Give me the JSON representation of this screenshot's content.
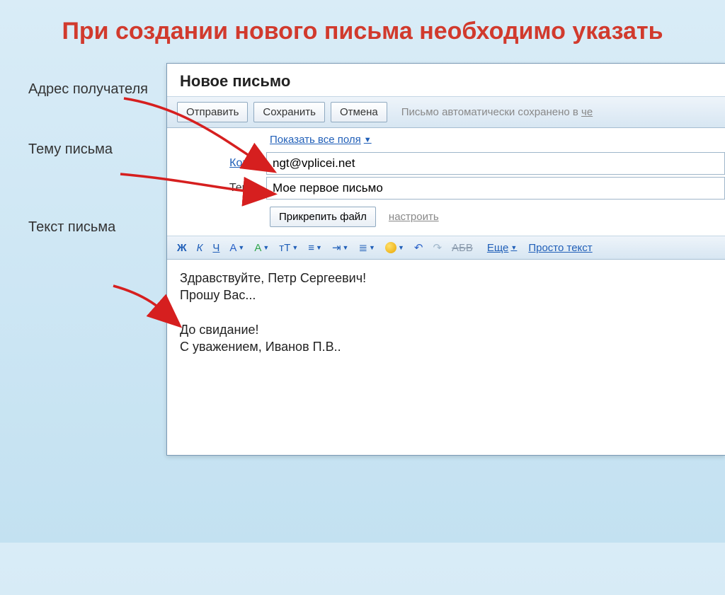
{
  "slide_title": "При создании нового письма необходимо указать",
  "labels": {
    "recipient": "Адрес получателя",
    "subject": "Тему письма",
    "body": "Текст письма"
  },
  "compose": {
    "title": "Новое письмо",
    "buttons": {
      "send": "Отправить",
      "save": "Сохранить",
      "cancel": "Отмена"
    },
    "auto_save_prefix": "Письмо автоматически сохранено в ",
    "auto_save_time": "че",
    "show_fields": "Показать все поля",
    "to_label": "Кому:",
    "to_value": "ngt@vplicei.net",
    "subject_label": "Тема:",
    "subject_value": "Мое первое письмо",
    "attach": "Прикрепить файл",
    "configure": "настроить",
    "editor": {
      "bold": "Ж",
      "italic": "К",
      "underline": "Ч",
      "font_color": "А",
      "highlight": "А",
      "font_size": "тТ",
      "more": "Еще",
      "plain": "Просто текст",
      "strike_label": "АБВ"
    },
    "body_line1": "Здравствуйте, Петр Сергеевич!",
    "body_line2": "Прошу Вас...",
    "body_line3": "До свидание!",
    "body_line4": "С уважением, Иванов П.В.."
  }
}
